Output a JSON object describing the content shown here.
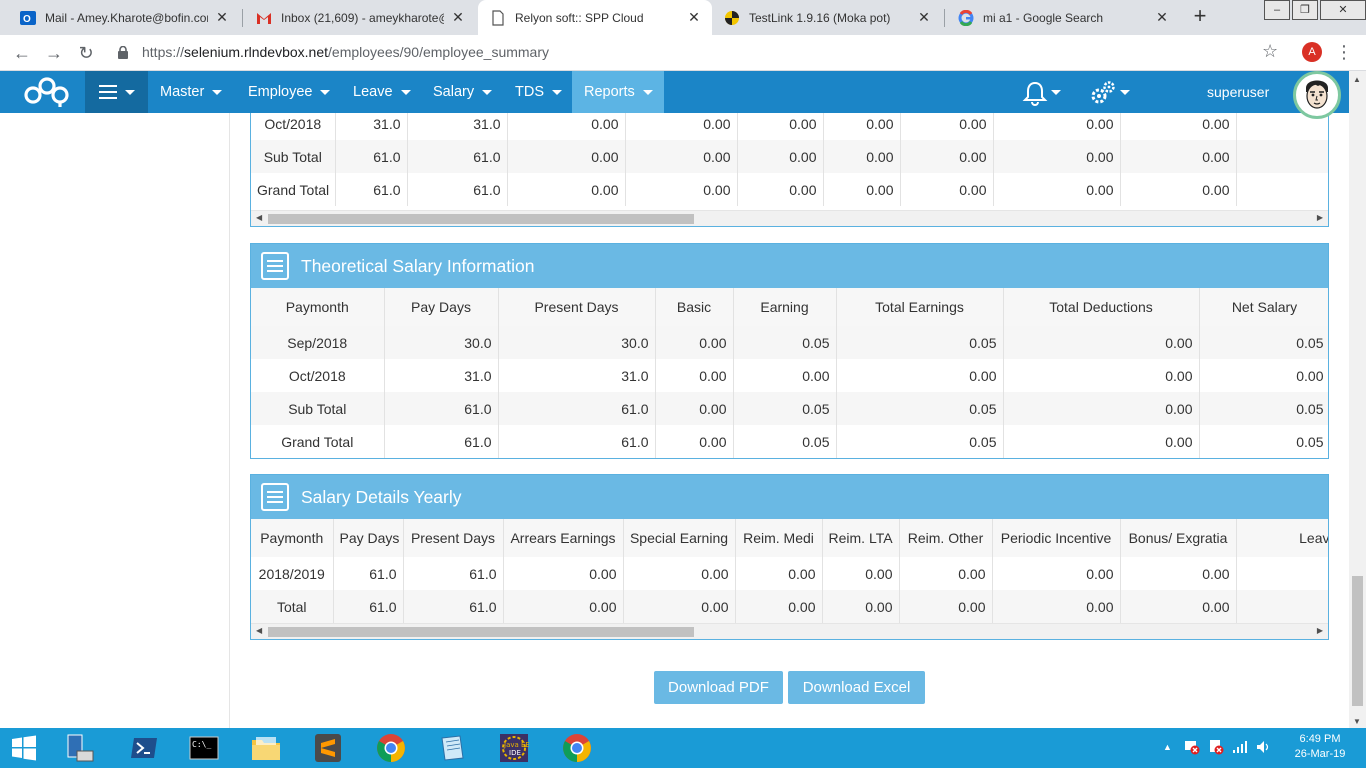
{
  "browser": {
    "tabs": [
      {
        "title": "Mail - Amey.Kharote@bofin.com",
        "icon": "outlook-icon",
        "active": false
      },
      {
        "title": "Inbox (21,609) - ameykharote@",
        "icon": "gmail-icon",
        "active": false
      },
      {
        "title": "Relyon soft:: SPP Cloud",
        "icon": "page-icon",
        "active": true
      },
      {
        "title": "TestLink 1.9.16 (Moka pot)",
        "icon": "testlink-icon",
        "active": false
      },
      {
        "title": "mi a1 - Google Search",
        "icon": "google-icon",
        "active": false
      }
    ],
    "url_scheme": "https://",
    "url_host": "selenium.rlndevbox.net",
    "url_path": "/employees/90/employee_summary",
    "profile_initial": "A"
  },
  "app": {
    "menu": [
      "Master",
      "Employee",
      "Leave",
      "Salary",
      "TDS",
      "Reports"
    ],
    "active_menu": "Reports",
    "username": "superuser"
  },
  "top_table": {
    "rows": [
      [
        "Oct/2018",
        "31.0",
        "31.0",
        "0.00",
        "0.00",
        "0.00",
        "0.00",
        "0.00",
        "0.00",
        "0.00",
        ""
      ],
      [
        "Sub Total",
        "61.0",
        "61.0",
        "0.00",
        "0.00",
        "0.00",
        "0.00",
        "0.00",
        "0.00",
        "0.00",
        ""
      ],
      [
        "Grand Total",
        "61.0",
        "61.0",
        "0.00",
        "0.00",
        "0.00",
        "0.00",
        "0.00",
        "0.00",
        "0.00",
        ""
      ]
    ]
  },
  "theoretical": {
    "title": "Theoretical Salary Information",
    "columns": [
      "Paymonth",
      "Pay Days",
      "Present Days",
      "Basic",
      "Earning",
      "Total Earnings",
      "Total Deductions",
      "Net Salary"
    ],
    "rows": [
      [
        "Sep/2018",
        "30.0",
        "30.0",
        "0.00",
        "0.05",
        "0.05",
        "0.00",
        "0.05"
      ],
      [
        "Oct/2018",
        "31.0",
        "31.0",
        "0.00",
        "0.00",
        "0.00",
        "0.00",
        "0.00"
      ],
      [
        "Sub Total",
        "61.0",
        "61.0",
        "0.00",
        "0.05",
        "0.05",
        "0.00",
        "0.05"
      ],
      [
        "Grand Total",
        "61.0",
        "61.0",
        "0.00",
        "0.05",
        "0.05",
        "0.00",
        "0.05"
      ]
    ]
  },
  "yearly": {
    "title": "Salary Details Yearly",
    "columns": [
      "Paymonth",
      "Pay Days",
      "Present Days",
      "Arrears Earnings",
      "Special Earning",
      "Reim. Medi",
      "Reim. LTA",
      "Reim. Other",
      "Periodic Incentive",
      "Bonus/ Exgratia",
      "Leave Encash"
    ],
    "rows": [
      [
        "2018/2019",
        "61.0",
        "61.0",
        "0.00",
        "0.00",
        "0.00",
        "0.00",
        "0.00",
        "0.00",
        "0.00",
        ""
      ],
      [
        "Total",
        "61.0",
        "61.0",
        "0.00",
        "0.00",
        "0.00",
        "0.00",
        "0.00",
        "0.00",
        "0.00",
        ""
      ]
    ]
  },
  "buttons": {
    "download_pdf": "Download PDF",
    "download_excel": "Download Excel"
  },
  "taskbar": {
    "time": "6:49 PM",
    "date": "26-Mar-19",
    "apps": [
      "start-icon",
      "file-server-icon",
      "powershell-icon",
      "cmd-icon",
      "file-explorer-icon",
      "sublime-icon",
      "chrome-icon",
      "notepad-icon",
      "java-ee-ide-icon",
      "chrome-icon"
    ]
  },
  "colors": {
    "appbar": "#1b85c7",
    "panel_header": "#6ab9e4",
    "taskbar": "#1a9bd6"
  }
}
